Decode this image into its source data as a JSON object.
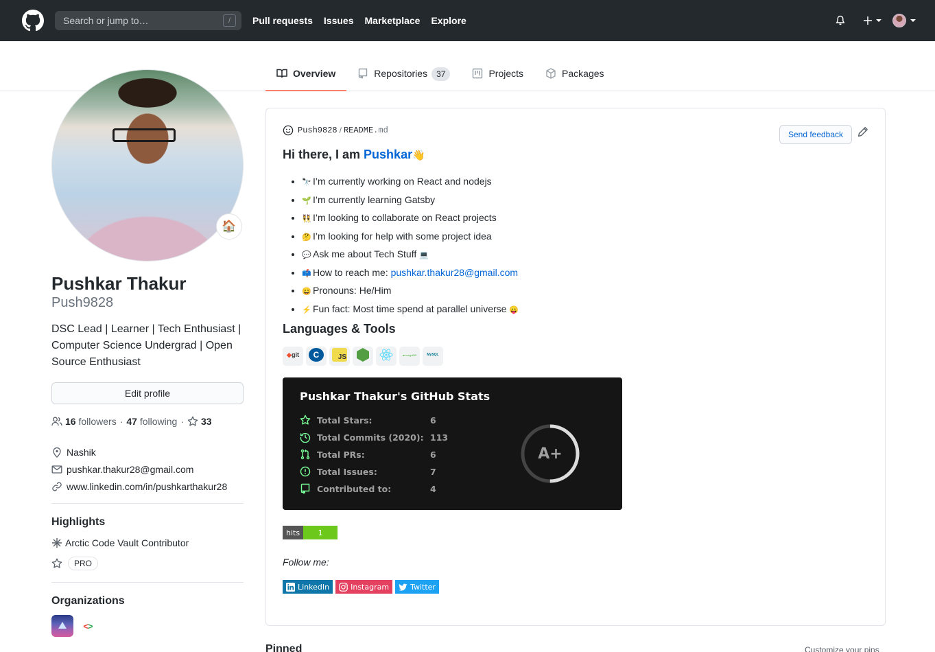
{
  "header": {
    "search_placeholder": "Search or jump to…",
    "search_shortcut": "/",
    "nav": [
      "Pull requests",
      "Issues",
      "Marketplace",
      "Explore"
    ],
    "icons": [
      "github-logo",
      "bell-icon",
      "plus-icon",
      "avatar"
    ]
  },
  "tabs": [
    {
      "label": "Overview",
      "icon": "book-icon",
      "active": true
    },
    {
      "label": "Repositories",
      "icon": "repo-icon",
      "count": "37"
    },
    {
      "label": "Projects",
      "icon": "project-icon"
    },
    {
      "label": "Packages",
      "icon": "package-icon"
    }
  ],
  "profile": {
    "status_emoji": "🏠",
    "full_name": "Pushkar Thakur",
    "login": "Push9828",
    "bio": "DSC Lead | Learner | Tech Enthusiast | Computer Science Undergrad | Open Source Enthusiast",
    "edit_label": "Edit profile",
    "followers_count": "16",
    "followers_label": "followers",
    "following_count": "47",
    "following_label": "following",
    "stars_count": "33",
    "location": "Nashik",
    "email": "pushkar.thakur28@gmail.com",
    "website": "www.linkedin.com/in/pushkarthakur28",
    "highlights_title": "Highlights",
    "highlight_arctic": "Arctic Code Vault Contributor",
    "highlight_pro": "PRO",
    "organizations_title": "Organizations"
  },
  "readme": {
    "owner": "Push9828",
    "file": "README",
    "ext": ".md",
    "feedback_label": "Send feedback",
    "greeting": "Hi there, I am ",
    "greeting_name": "Pushkar",
    "greeting_emoji": "👋",
    "items": [
      {
        "emoji": "🔭",
        "text": "I’m currently working on React and nodejs"
      },
      {
        "emoji": "🌱",
        "text": "I’m currently learning Gatsby"
      },
      {
        "emoji": "👯",
        "text": "I’m looking to collaborate on React projects"
      },
      {
        "emoji": "🤔",
        "text": "I’m looking for help with some project idea"
      },
      {
        "emoji": "💬",
        "text": "Ask me about Tech Stuff",
        "suffix": "💻"
      },
      {
        "emoji": "📫",
        "text": "How to reach me: ",
        "link": "pushkar.thakur28@gmail.com"
      },
      {
        "emoji": "😄",
        "text": "Pronouns: He/Him"
      },
      {
        "emoji": "⚡",
        "text": "Fun fact: Most time spend at parallel universe",
        "suffix": "😛"
      }
    ],
    "languages_title": "Languages & Tools",
    "tools": [
      "git",
      "C++",
      "JS",
      "Node.js",
      "React",
      "MongoDB",
      "MySQL"
    ],
    "stats": {
      "title": "Pushkar Thakur's GitHub Stats",
      "rows": [
        {
          "label": "Total Stars:",
          "value": "6"
        },
        {
          "label": "Total Commits (2020):",
          "value": "113"
        },
        {
          "label": "Total PRs:",
          "value": "6"
        },
        {
          "label": "Total Issues:",
          "value": "7"
        },
        {
          "label": "Contributed to:",
          "value": "4"
        }
      ],
      "rank": "A+",
      "rank_progress": 0.5,
      "accent": "#79ff97"
    },
    "hits_label": "hits",
    "hits_value": "1",
    "follow_me": "Follow me:",
    "socials": [
      {
        "label": "LinkedIn",
        "color": "#0e76a8"
      },
      {
        "label": "Instagram",
        "color": "#e4405f"
      },
      {
        "label": "Twitter",
        "color": "#1da1f2"
      }
    ]
  },
  "pinned": {
    "title": "Pinned",
    "customize_label": "Customize your pins"
  }
}
